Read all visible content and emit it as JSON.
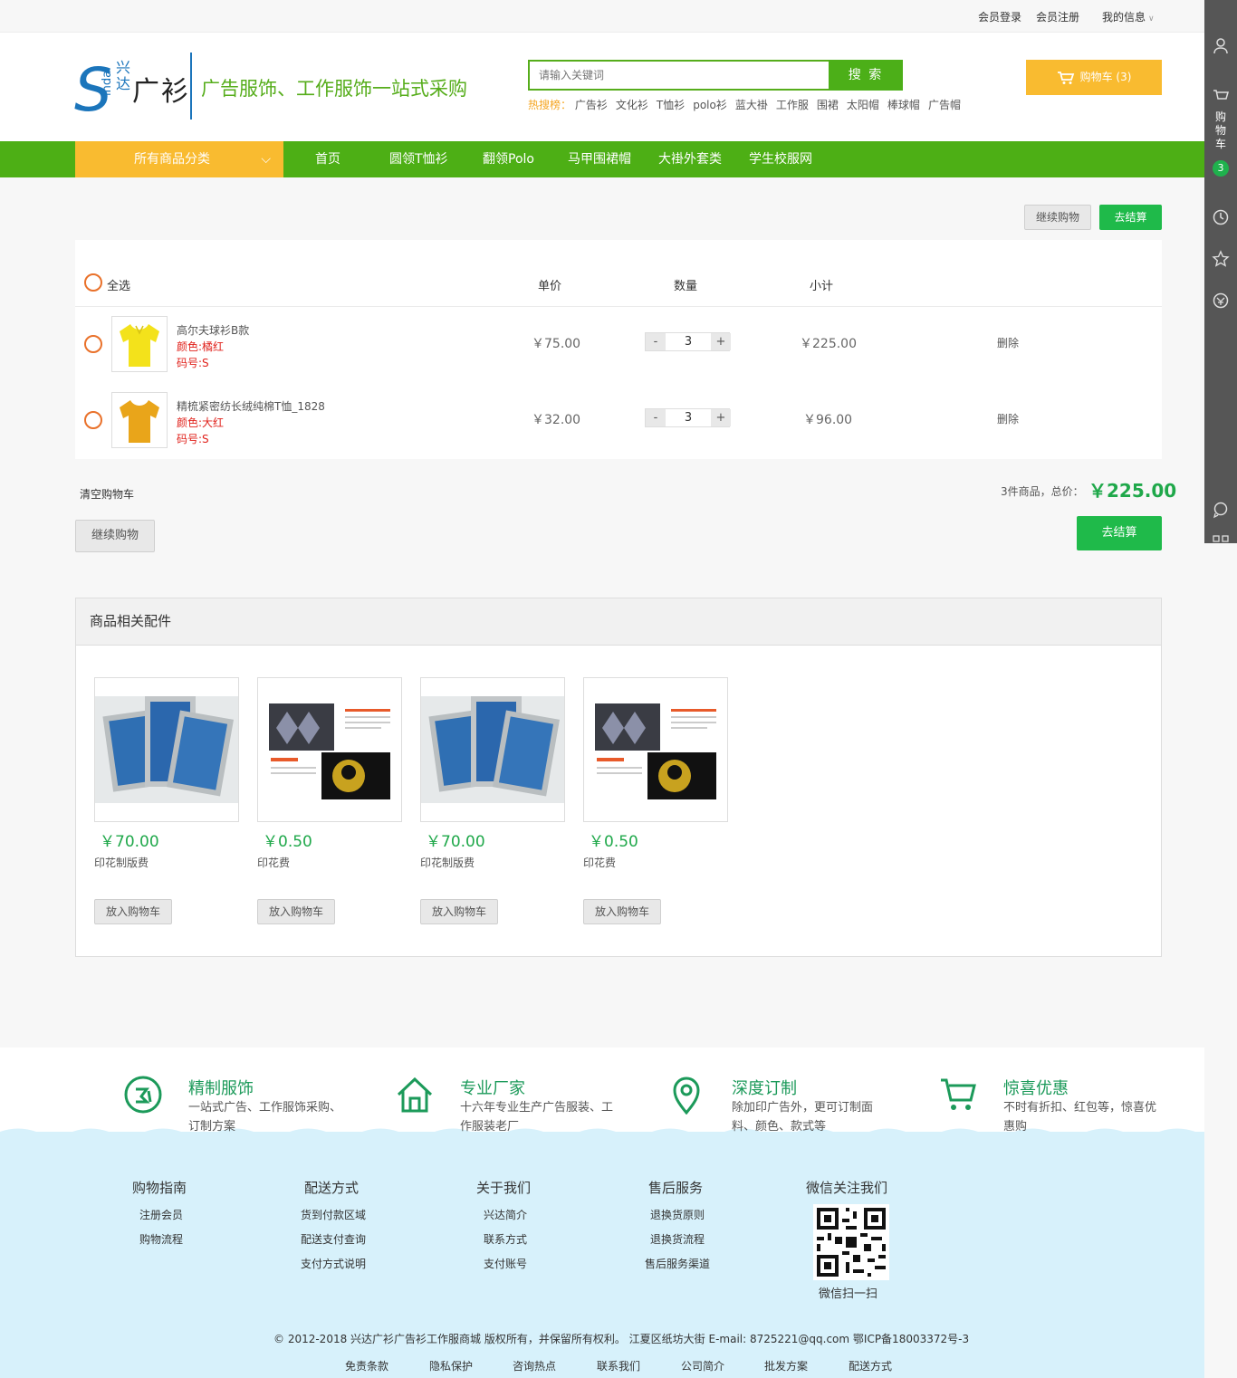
{
  "topbar": {
    "login": "会员登录",
    "register": "会员注册",
    "myinfo": "我的信息"
  },
  "logo": {
    "brand_en": "Sinda",
    "brand_cn_small": "兴达",
    "brand_cn_big": "广衫",
    "slogan": "广告服饰、工作服饰一站式采购"
  },
  "search": {
    "placeholder": "请输入关键词",
    "button": "搜 索",
    "hot_label": "热搜榜：",
    "hot_words": [
      "广告衫",
      "文化衫",
      "T恤衫",
      "polo衫",
      "蓝大褂",
      "工作服",
      "围裙",
      "太阳帽",
      "棒球帽",
      "广告帽"
    ]
  },
  "cart_button": "购物车 (3)",
  "nav": {
    "all": "所有商品分类",
    "items": [
      "首页",
      "圆领T恤衫",
      "翻领Polo",
      "马甲围裙帽",
      "大褂外套类",
      "学生校服网"
    ]
  },
  "sidebar": {
    "cart_label": "购物车",
    "cart_count": "3"
  },
  "actions": {
    "continue": "继续购物",
    "checkout": "去结算",
    "clear": "清空购物车"
  },
  "table": {
    "select_all": "全选",
    "headers": {
      "price": "单价",
      "qty": "数量",
      "subtotal": "小计"
    },
    "rows": [
      {
        "name": "高尔夫球衫B款",
        "color": "颜色:橘红",
        "size": "码号:S",
        "price": "￥75.00",
        "qty": "3",
        "subtotal": "￥225.00",
        "delete": "删除",
        "shirt_color": "#f3e21b"
      },
      {
        "name": "精梳紧密纺长绒纯棉T恤_1828",
        "color": "颜色:大红",
        "size": "码号:S",
        "price": "￥32.00",
        "qty": "3",
        "subtotal": "￥96.00",
        "delete": "删除",
        "shirt_color": "#e9a51a"
      }
    ],
    "qty_minus": "-",
    "qty_plus": "+"
  },
  "summary": {
    "label": "3件商品，总价：",
    "total": "￥225.00"
  },
  "accessories": {
    "title": "商品相关配件",
    "items": [
      {
        "price": "￥70.00",
        "name": "印花制版费",
        "button": "放入购物车",
        "kind": "frames"
      },
      {
        "price": "￥0.50",
        "name": "印花费",
        "button": "放入购物车",
        "kind": "print"
      },
      {
        "price": "￥70.00",
        "name": "印花制版费",
        "button": "放入购物车",
        "kind": "frames"
      },
      {
        "price": "￥0.50",
        "name": "印花费",
        "button": "放入购物车",
        "kind": "print"
      }
    ]
  },
  "features": [
    {
      "title": "精制服饰",
      "desc": "一站式广告、工作服饰采购、订制方案",
      "icon": "badge-icon"
    },
    {
      "title": "专业厂家",
      "desc": "十六年专业生产广告服装、工作服装老厂",
      "icon": "house-icon"
    },
    {
      "title": "深度订制",
      "desc": "除加印广告外，更可订制面料、颜色、款式等",
      "icon": "location-icon"
    },
    {
      "title": "惊喜优惠",
      "desc": "不时有折扣、红包等，惊喜优惠购",
      "icon": "cart-icon"
    }
  ],
  "footer": {
    "columns": [
      {
        "title": "购物指南",
        "items": [
          "注册会员",
          "购物流程"
        ]
      },
      {
        "title": "配送方式",
        "items": [
          "货到付款区域",
          "配送支付查询",
          "支付方式说明"
        ]
      },
      {
        "title": "关于我们",
        "items": [
          "兴达简介",
          "联系方式",
          "支付账号"
        ]
      },
      {
        "title": "售后服务",
        "items": [
          "退换货原则",
          "退换货流程",
          "售后服务渠道"
        ]
      }
    ],
    "wechat_title": "微信关注我们",
    "wechat_caption": "微信扫一扫",
    "copyright": "© 2012-2018 兴达广衫广告衫工作服商城 版权所有，并保留所有权利。 江夏区纸坊大街 E-mail: 8725221@qq.com 鄂ICP备18003372号-3",
    "links": [
      "免责条款",
      "隐私保护",
      "咨询热点",
      "联系我们",
      "公司简介",
      "批发方案",
      "配送方式"
    ]
  },
  "colors": {
    "green": "#4daf15",
    "yellow": "#f9bb30",
    "price_green": "#1fa84a",
    "attr_red": "#e0211b",
    "radio_orange": "#e9712a"
  }
}
